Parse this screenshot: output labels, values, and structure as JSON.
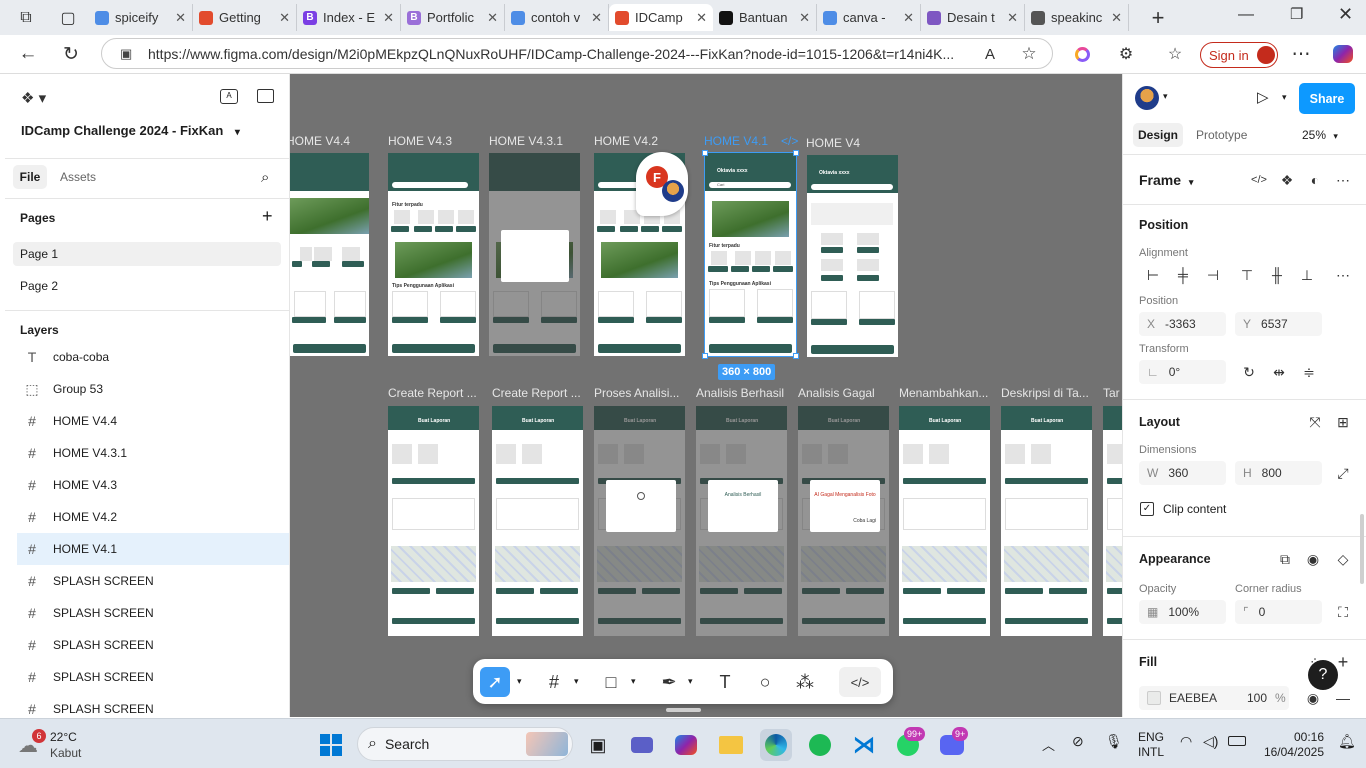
{
  "browser": {
    "tabs": [
      {
        "label": "spiceify",
        "fav": "search-icon",
        "color": "#4e8de6"
      },
      {
        "label": "Getting",
        "fav": "figma-icon",
        "color": "#e24b2d"
      },
      {
        "label": "Index - E",
        "fav": "B",
        "color": "#7b3fe4"
      },
      {
        "label": "Portfolic",
        "fav": "B",
        "color": "#9a6fd8"
      },
      {
        "label": "contoh v",
        "fav": "search-icon",
        "color": "#4e8de6"
      },
      {
        "label": "IDCamp",
        "fav": "figma-icon",
        "color": "#e24b2d",
        "active": true
      },
      {
        "label": "Bantuan",
        "fav": "github-icon",
        "color": "#111"
      },
      {
        "label": "canva -",
        "fav": "search-icon",
        "color": "#4e8de6"
      },
      {
        "label": "Desain t",
        "fav": "canva-icon",
        "color": "#7e57c2"
      },
      {
        "label": "speakinc",
        "fav": "globe-icon",
        "color": "#555"
      }
    ],
    "url": "https://www.figma.com/design/M2i0pMEkpzQLnQNuxRoUHF/IDCamp-Challenge-2024---FixKan?node-id=1015-1206&t=r14ni4K...",
    "signin_label": "Sign in"
  },
  "left": {
    "file_title": "IDCamp Challenge 2024 - FixKan",
    "tab_file": "File",
    "tab_assets": "Assets",
    "pages_label": "Pages",
    "pages": [
      "Page 1",
      "Page 2"
    ],
    "layers_label": "Layers",
    "layers": [
      {
        "icon": "T",
        "label": "coba-coba"
      },
      {
        "icon": "⬚",
        "label": "Group 53"
      },
      {
        "icon": "#",
        "label": "HOME V4.4"
      },
      {
        "icon": "#",
        "label": "HOME V4.3.1"
      },
      {
        "icon": "#",
        "label": "HOME V4.3"
      },
      {
        "icon": "#",
        "label": "HOME V4.2"
      },
      {
        "icon": "#",
        "label": "HOME V4.1",
        "selected": true
      },
      {
        "icon": "#",
        "label": "SPLASH SCREEN"
      },
      {
        "icon": "#",
        "label": "SPLASH SCREEN"
      },
      {
        "icon": "#",
        "label": "SPLASH SCREEN"
      },
      {
        "icon": "#",
        "label": "SPLASH SCREEN"
      },
      {
        "icon": "#",
        "label": "SPLASH SCREEN"
      }
    ]
  },
  "canvas": {
    "top_frames": [
      "HOME V4.4",
      "HOME V4.3",
      "HOME V4.3.1",
      "HOME V4.2",
      "HOME V4.1",
      "HOME V4"
    ],
    "bottom_frames": [
      "Create Report ...",
      "Create Report ...",
      "Proses Analisi...",
      "Analisis Berhasil",
      "Analisis Gagal",
      "Menambahkan...",
      "Deskripsi di Ta...",
      "Tar"
    ],
    "selection_size": "360 × 800",
    "code_icon_label": "</>",
    "avatar_letter": "F",
    "frame_texts": {
      "user": "Oktavia xxxx",
      "search": "Cari",
      "fitur": "Fitur terpadu",
      "tips": "Tips Penggunaan Aplikasi",
      "report_title": "Buat Laporan",
      "analisis_ok": "Analisis Berhasil",
      "analisis_fail": "AI Gagal Menganalisis Foto",
      "coba_lagi": "Coba Lagi"
    }
  },
  "right": {
    "tab_design": "Design",
    "tab_prototype": "Prototype",
    "zoom": "25%",
    "share_label": "Share",
    "frame_label": "Frame",
    "position_label": "Position",
    "alignment_label": "Alignment",
    "position_sub": "Position",
    "x_label": "X",
    "x_value": "-3363",
    "y_label": "Y",
    "y_value": "6537",
    "transform_label": "Transform",
    "rotation": "0°",
    "layout_label": "Layout",
    "dimensions_label": "Dimensions",
    "w_label": "W",
    "w_value": "360",
    "h_label": "H",
    "h_value": "800",
    "clip_label": "Clip content",
    "appearance_label": "Appearance",
    "opacity_label": "Opacity",
    "opacity_value": "100%",
    "radius_label": "Corner radius",
    "radius_value": "0",
    "fill_label": "Fill",
    "fill_hex": "EAEBEA",
    "fill_opacity": "100",
    "fill_pct": "%"
  },
  "taskbar": {
    "weather_temp": "22°C",
    "weather_desc": "Kabut",
    "weather_badge": "6",
    "search_label": "Search",
    "whatsapp_badge": "99+",
    "discord_badge": "9+",
    "lang1": "ENG",
    "lang2": "INTL",
    "time": "00:16",
    "date": "16/04/2025"
  }
}
